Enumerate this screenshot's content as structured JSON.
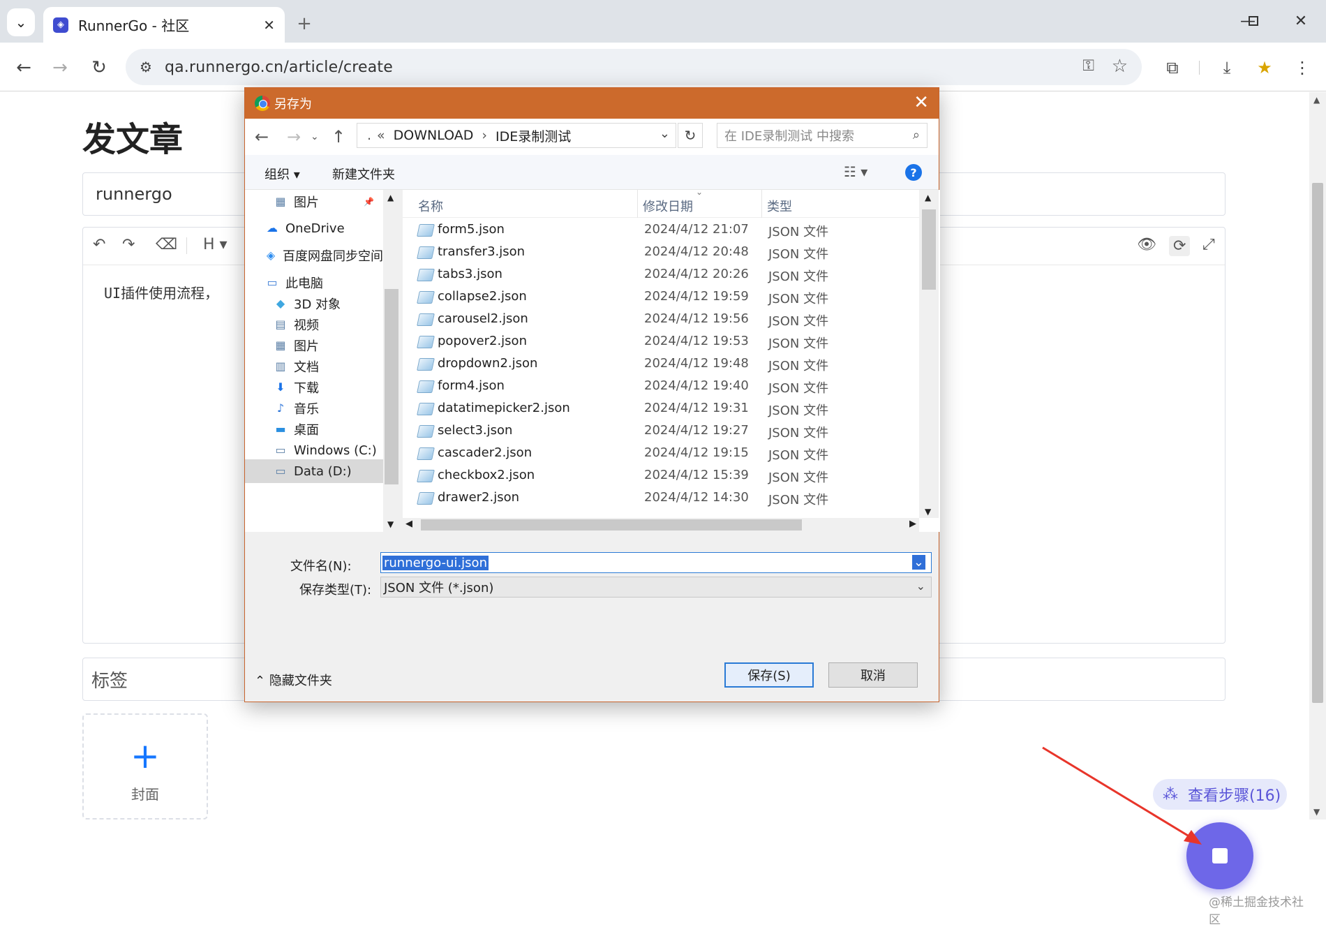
{
  "browser": {
    "tab_title": "RunnerGo - 社区",
    "tab_favicon": "runnergo-favicon",
    "url": "qa.runnergo.cn/article/create"
  },
  "page": {
    "title": "发文章",
    "title_input_value": "runnergo",
    "editor_text": "UI插件使用流程，",
    "editor_heading_label": "H",
    "tags_placeholder": "标签",
    "cover_label": "封面",
    "steps_button_label": "查看步骤(16)",
    "watermark": "@稀土掘金技术社区"
  },
  "dialog": {
    "title": "另存为",
    "path": {
      "prefix": "«",
      "segments": [
        "DOWNLOAD",
        "IDE录制测试"
      ]
    },
    "search_placeholder": "在 IDE录制测试 中搜索",
    "organize_label": "组织",
    "new_folder_label": "新建文件夹",
    "nav_items": [
      {
        "label": "图片",
        "icon": "pictures-icon",
        "pinned": true
      },
      {
        "label": "OneDrive",
        "icon": "onedrive-icon"
      },
      {
        "label": "百度网盘同步空间",
        "icon": "baidu-netdisk-icon"
      },
      {
        "label": "此电脑",
        "icon": "this-pc-icon"
      },
      {
        "label": "3D 对象",
        "icon": "3d-objects-icon"
      },
      {
        "label": "视频",
        "icon": "videos-icon"
      },
      {
        "label": "图片",
        "icon": "pictures-icon"
      },
      {
        "label": "文档",
        "icon": "documents-icon"
      },
      {
        "label": "下载",
        "icon": "downloads-icon"
      },
      {
        "label": "音乐",
        "icon": "music-icon"
      },
      {
        "label": "桌面",
        "icon": "desktop-icon"
      },
      {
        "label": "Windows (C:)",
        "icon": "drive-c-icon"
      },
      {
        "label": "Data (D:)",
        "icon": "drive-d-icon",
        "selected": true
      }
    ],
    "columns": [
      "名称",
      "修改日期",
      "类型"
    ],
    "files": [
      {
        "name": "form5.json",
        "date": "2024/4/12 21:07",
        "type": "JSON 文件"
      },
      {
        "name": "transfer3.json",
        "date": "2024/4/12 20:48",
        "type": "JSON 文件"
      },
      {
        "name": "tabs3.json",
        "date": "2024/4/12 20:26",
        "type": "JSON 文件"
      },
      {
        "name": "collapse2.json",
        "date": "2024/4/12 19:59",
        "type": "JSON 文件"
      },
      {
        "name": "carousel2.json",
        "date": "2024/4/12 19:56",
        "type": "JSON 文件"
      },
      {
        "name": "popover2.json",
        "date": "2024/4/12 19:53",
        "type": "JSON 文件"
      },
      {
        "name": "dropdown2.json",
        "date": "2024/4/12 19:48",
        "type": "JSON 文件"
      },
      {
        "name": "form4.json",
        "date": "2024/4/12 19:40",
        "type": "JSON 文件"
      },
      {
        "name": "datatimepicker2.json",
        "date": "2024/4/12 19:31",
        "type": "JSON 文件"
      },
      {
        "name": "select3.json",
        "date": "2024/4/12 19:27",
        "type": "JSON 文件"
      },
      {
        "name": "cascader2.json",
        "date": "2024/4/12 19:15",
        "type": "JSON 文件"
      },
      {
        "name": "checkbox2.json",
        "date": "2024/4/12 15:39",
        "type": "JSON 文件"
      },
      {
        "name": "drawer2.json",
        "date": "2024/4/12 14:30",
        "type": "JSON 文件"
      }
    ],
    "filename_label": "文件名(N):",
    "filename_value": "runnergo-ui.json",
    "filetype_label": "保存类型(T):",
    "filetype_value": "JSON 文件 (*.json)",
    "hide_folders_label": "隐藏文件夹",
    "save_label": "保存(S)",
    "cancel_label": "取消"
  },
  "colors": {
    "dialog_titlebar": "#cc6a2c",
    "accent": "#6e67e8",
    "link_blue": "#1677ff"
  }
}
